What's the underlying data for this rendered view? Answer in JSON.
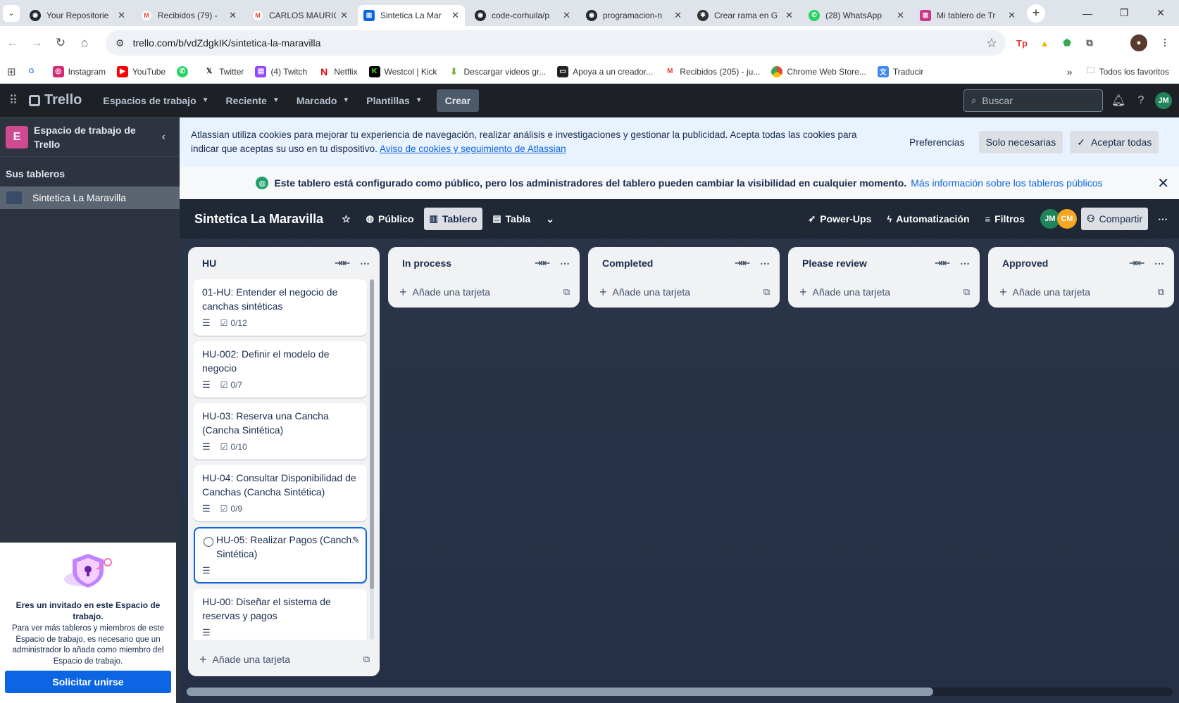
{
  "browser": {
    "tabs": [
      {
        "title": "Your Repositorie",
        "icon": "github-icon",
        "active": false
      },
      {
        "title": "Recibidos (79) -",
        "icon": "gmail-icon",
        "active": false
      },
      {
        "title": "CARLOS MAURIC",
        "icon": "gmail-icon",
        "active": false
      },
      {
        "title": "Sintetica La Mar",
        "icon": "trello-icon",
        "active": true
      },
      {
        "title": "code-corhuila/p",
        "icon": "github-icon",
        "active": false
      },
      {
        "title": "programacion-n",
        "icon": "github-icon",
        "active": false
      },
      {
        "title": "Crear rama en G",
        "icon": "openai-icon",
        "active": false
      },
      {
        "title": "(28) WhatsApp",
        "icon": "whatsapp-icon",
        "active": false
      },
      {
        "title": "Mi tablero de Tr",
        "icon": "trello-icon",
        "active": false
      }
    ],
    "url": "trello.com/b/vdZdgkIK/sintetica-la-maravilla",
    "bookmarks": [
      {
        "label": "",
        "icon": "google-icon"
      },
      {
        "label": "Instagram",
        "icon": "instagram-icon"
      },
      {
        "label": "YouTube",
        "icon": "youtube-icon"
      },
      {
        "label": "",
        "icon": "whatsapp-icon"
      },
      {
        "label": "Twitter",
        "icon": "x-icon"
      },
      {
        "label": "(4) Twitch",
        "icon": "twitch-icon"
      },
      {
        "label": "Netflix",
        "icon": "netflix-icon"
      },
      {
        "label": "Westcol | Kick",
        "icon": "kick-icon"
      },
      {
        "label": "Descargar videos gr...",
        "icon": "download-icon"
      },
      {
        "label": "Apoya a un creador...",
        "icon": "creator-icon"
      },
      {
        "label": "Recibidos (205) - ju...",
        "icon": "gmail-icon"
      },
      {
        "label": "Chrome Web Store...",
        "icon": "chrome-store-icon"
      },
      {
        "label": "Traducir",
        "icon": "translate-icon"
      }
    ],
    "all_bookmarks": "Todos los favoritos"
  },
  "header": {
    "logo": "Trello",
    "menus": [
      "Espacios de trabajo",
      "Reciente",
      "Marcado",
      "Plantillas"
    ],
    "create": "Crear",
    "search_placeholder": "Buscar",
    "user_initials": "JM"
  },
  "sidebar": {
    "workspace_letter": "E",
    "workspace_name": "Espacio de trabajo de Trello",
    "boards_title": "Sus tableros",
    "boards": [
      "Sintetica La Maravilla"
    ],
    "invite": {
      "heading": "Eres un invitado en este Espacio de trabajo.",
      "body": "Para ver más tableros y miembros de este Espacio de trabajo, es necesario que un administrador lo añada como miembro del Espacio de trabajo.",
      "button": "Solicitar unirse"
    }
  },
  "cookie": {
    "text": "Atlassian utiliza cookies para mejorar tu experiencia de navegación, realizar análisis e investigaciones y gestionar la publicidad. Acepta todas las cookies para indicar que aceptas su uso en tu dispositivo.",
    "link": "Aviso de cookies y seguimiento de Atlassian",
    "prefs": "Preferencias",
    "necessary": "Solo necesarias",
    "accept": "Aceptar todas"
  },
  "notice": {
    "text": "Este tablero está configurado como público, pero los administradores del tablero pueden cambiar la visibilidad en cualquier momento.",
    "link": "Más información sobre los tableros públicos"
  },
  "board": {
    "name": "Sintetica La Maravilla",
    "visibility": "Público",
    "view_board": "Tablero",
    "view_table": "Tabla",
    "powerups": "Power-Ups",
    "automation": "Automatización",
    "filters": "Filtros",
    "members": [
      {
        "initials": "JM",
        "color": "#1f845a"
      },
      {
        "initials": "CM",
        "color": "#f5a623"
      }
    ],
    "share": "Compartir",
    "add_card": "Añade una tarjeta",
    "lists": [
      {
        "title": "HU",
        "cards": [
          {
            "title": "01-HU: Entender el negocio de canchas sintéticas",
            "checklist": "0/12"
          },
          {
            "title": "HU-002: Definir el modelo de negocio",
            "checklist": "0/7"
          },
          {
            "title": "HU-03: Reserva una Cancha (Cancha Sintética)",
            "checklist": "0/10"
          },
          {
            "title": "HU-04: Consultar Disponibilidad de Canchas (Cancha Sintética)",
            "checklist": "0/9"
          },
          {
            "title": "HU-05: Realizar Pagos (Canch. Sintética)",
            "checklist": ""
          },
          {
            "title": "HU-00: Diseñar el sistema de reservas y pagos",
            "checklist": ""
          }
        ]
      },
      {
        "title": "In process",
        "cards": []
      },
      {
        "title": "Completed",
        "cards": []
      },
      {
        "title": "Please review",
        "cards": []
      },
      {
        "title": "Approved",
        "cards": []
      }
    ]
  }
}
